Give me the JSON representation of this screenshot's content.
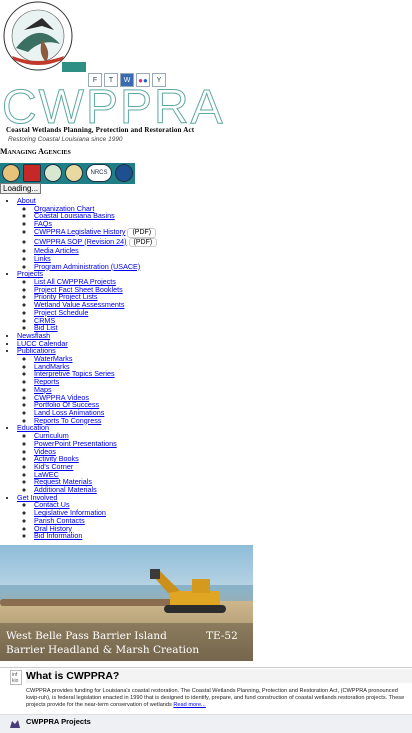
{
  "header": {
    "brand": "CWPPRA",
    "subtitle": "Coastal Wetlands Planning, Protection and Restoration Act",
    "tagline": "Restoring Coastal Louisiana since 1990",
    "seal_text": "COASTAL WETLANDS PLANNING, PROTECTION AND RESTORATION ACT",
    "social": [
      {
        "icon": "facebook-icon",
        "label": "F"
      },
      {
        "icon": "twitter-icon",
        "label": "T"
      },
      {
        "icon": "blog-icon",
        "label": "W"
      },
      {
        "icon": "flickr-icon",
        "label": "●●"
      },
      {
        "icon": "youtube-icon",
        "label": "Y"
      }
    ]
  },
  "agencies": {
    "title": "Managing Agencies",
    "logos": [
      "epa-logo",
      "usace-logo",
      "doi-logo",
      "usfws-logo",
      "nrcs-logo",
      "noaa-logo"
    ]
  },
  "loading": "Loading...",
  "nav": {
    "about": {
      "label": "About",
      "items": [
        "Organization Chart",
        "Coastal Louisiana Basins",
        "FAQs",
        "CWPPRA Legislative History",
        "CWPPRA SOP (Revision 24)",
        "Media Articles",
        "Links",
        "Program Administration (USACE)"
      ],
      "pdf": "(PDF)"
    },
    "projects": {
      "label": "Projects",
      "items": [
        "List All CWPPRA Projects",
        "Project Fact Sheet Booklets",
        "Priority Project Lists",
        "Wetland Value Assessments",
        "Project Schedule",
        "CRMS",
        "Bid List"
      ]
    },
    "newsflash": "Newsflash",
    "lucc": "LUCC Calendar",
    "publications": {
      "label": "Publications",
      "items": [
        "WaterMarks",
        "LandMarks",
        "Interpretive Topics Series",
        "Reports",
        "Maps",
        "CWPPRA Videos",
        "Portfolio Of Success",
        "Land Loss Animations",
        "Reports To Congress"
      ]
    },
    "education": {
      "label": "Education",
      "items": [
        "Curriculum",
        "PowerPoint Presentations",
        "Videos",
        "Activity Books",
        "Kid's Corner",
        "LaWEC",
        "Request Materials",
        "Additional Materials"
      ]
    },
    "getinvolved": {
      "label": "Get Involved",
      "items": [
        "Contact Us",
        "Legislative Information",
        "Parish Contacts",
        "Oral History",
        "Bid Information"
      ]
    }
  },
  "hero": {
    "line1": "West Belle Pass Barrier Island",
    "line2": "Barrier Headland & Marsh Creation",
    "code": "TE-52"
  },
  "whatis": {
    "icon_text": "inf kio",
    "title": "What is CWPPRA?",
    "body": "CWPPRA provides funding for Louisiana's coastal restoration. The Coastal Wetlands Planning, Protection and Restoration Act, (CWPPRA pronounced kwip-ruh), is federal legislation enacted in 1990 that is designed to identify, prepare, and fund construction of coastal wetlands restoration projects. These projects provide for the near-term conservation of wetlands",
    "more": "Read more..."
  },
  "projects_bar": {
    "title": "CWPPRA Projects"
  }
}
